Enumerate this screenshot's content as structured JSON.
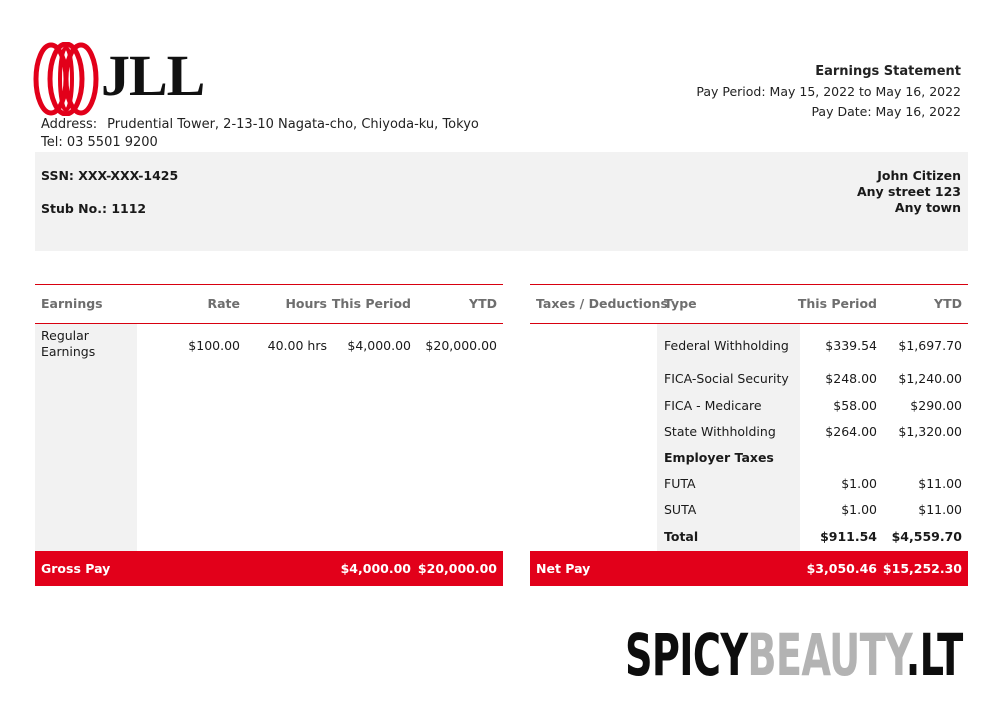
{
  "brand": {
    "logo_text": "JLL",
    "logo_color": "#e2001a"
  },
  "company": {
    "address_label": "Address:",
    "address": "Prudential Tower, 2-13-10 Nagata-cho, Chiyoda-ku, Tokyo",
    "tel": "Tel: 03 5501 9200"
  },
  "statement": {
    "title": "Earnings Statement",
    "pay_period": "Pay Period: May 15, 2022 to May 16, 2022",
    "pay_date": "Pay Date: May 16, 2022"
  },
  "employee": {
    "ssn": "SSN: XXX-XXX-1425",
    "stub": "Stub No.: 1112",
    "name": "John Citizen",
    "street": "Any street 123",
    "town": "Any town"
  },
  "earnings": {
    "headers": [
      "Earnings",
      "Rate",
      "Hours",
      "This Period",
      "YTD"
    ],
    "rows": [
      {
        "name": "Regular Earnings",
        "rate": "$100.00",
        "hours": "40.00 hrs",
        "period": "$4,000.00",
        "ytd": "$20,000.00"
      }
    ],
    "gross_label": "Gross Pay",
    "gross_period": "$4,000.00",
    "gross_ytd": "$20,000.00"
  },
  "taxes": {
    "headers": [
      "Taxes / Deductions",
      "Type",
      "This Period",
      "YTD"
    ],
    "rows": [
      {
        "type": "Federal Withholding",
        "period": "$339.54",
        "ytd": "$1,697.70"
      },
      {
        "type": "FICA-Social Security",
        "period": "$248.00",
        "ytd": "$1,240.00"
      },
      {
        "type": "FICA - Medicare",
        "period": "$58.00",
        "ytd": "$290.00"
      },
      {
        "type": "State Withholding",
        "period": "$264.00",
        "ytd": "$1,320.00"
      },
      {
        "type": "Employer Taxes",
        "period": "",
        "ytd": ""
      },
      {
        "type": "FUTA",
        "period": "$1.00",
        "ytd": "$11.00"
      },
      {
        "type": "SUTA",
        "period": "$1.00",
        "ytd": "$11.00"
      },
      {
        "type": "Total",
        "period": "$911.54",
        "ytd": "$4,559.70"
      }
    ],
    "net_label": "Net Pay",
    "net_period": "$3,050.46",
    "net_ytd": "$15,252.30"
  },
  "watermark": {
    "part1": "SPICY",
    "part2": "BEAUTY",
    "part3": ".LT"
  }
}
